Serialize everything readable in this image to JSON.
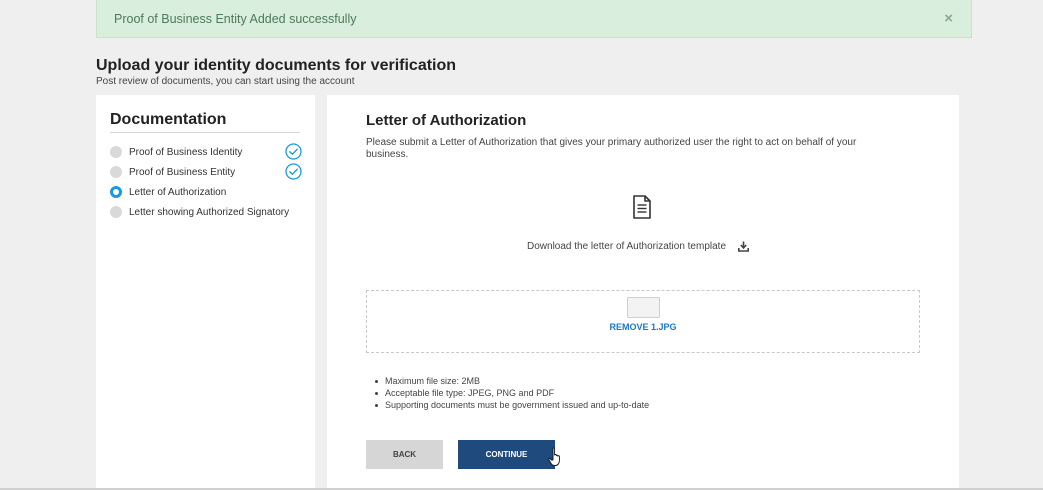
{
  "alert": {
    "message": "Proof of Business Entity Added successfully",
    "close": "×"
  },
  "header": {
    "title": "Upload your identity documents for verification",
    "subtitle": "Post review of documents, you can start using the account"
  },
  "sidebar": {
    "title": "Documentation",
    "steps": [
      {
        "label": "Proof of Business Identity",
        "completed": true,
        "active": false
      },
      {
        "label": "Proof of Business Entity",
        "completed": true,
        "active": false
      },
      {
        "label": "Letter of Authorization",
        "completed": false,
        "active": true
      },
      {
        "label": "Letter showing Authorized Signatory",
        "completed": false,
        "active": false
      }
    ]
  },
  "main": {
    "title": "Letter of Authorization",
    "description": "Please submit a Letter of Authorization that gives your primary authorized user the right to act on behalf of your business.",
    "download_label": "Download the letter of Authorization template",
    "upload": {
      "remove_label": "REMOVE 1.JPG"
    },
    "rules": [
      "Maximum file size: 2MB",
      "Acceptable file type: JPEG, PNG and PDF",
      "Supporting documents must be government issued and up-to-date"
    ],
    "back_label": "BACK",
    "continue_label": "CONTINUE"
  },
  "colors": {
    "accent": "#1b98e0",
    "primary_button": "#1f4a7e",
    "alert_bg": "#d9eedd",
    "alert_text": "#4d7a5a",
    "link": "#1b78c2"
  }
}
